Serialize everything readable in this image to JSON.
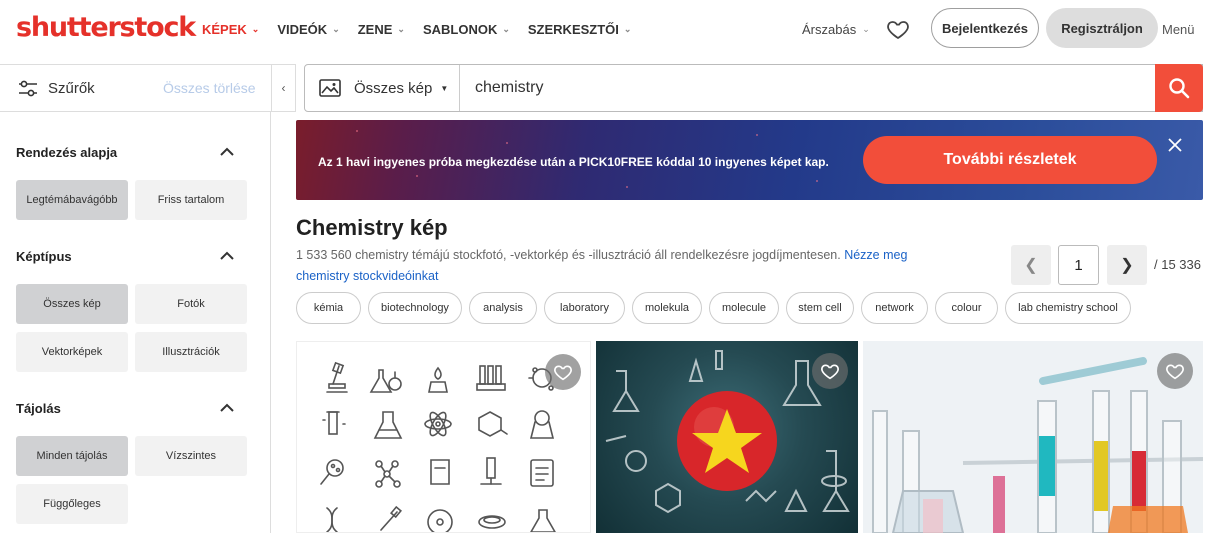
{
  "brand": {
    "logo_text": "shutterstock",
    "accent": "#e5312a"
  },
  "nav": {
    "items": [
      {
        "label": "KÉPEK",
        "active": true
      },
      {
        "label": "VIDEÓK",
        "active": false
      },
      {
        "label": "ZENE",
        "active": false
      },
      {
        "label": "SABLONOK",
        "active": false
      },
      {
        "label": "SZERKESZTŐI",
        "active": false
      }
    ],
    "pricing": "Árszabás",
    "login": "Bejelentkezés",
    "register": "Regisztráljon",
    "menu": "Menü"
  },
  "filters": {
    "label": "Szűrők",
    "clear_all": "Összes törlése"
  },
  "search": {
    "type_label": "Összes kép",
    "query": "chemistry"
  },
  "sidebar": {
    "sort": {
      "title": "Rendezés alapja",
      "options": [
        "Legtémábavágóbb",
        "Friss tartalom"
      ],
      "selected": 0
    },
    "type": {
      "title": "Képtípus",
      "options": [
        "Összes kép",
        "Fotók",
        "Vektorképek",
        "Illusztrációk"
      ],
      "selected": 0
    },
    "orientation": {
      "title": "Tájolás",
      "options": [
        "Minden tájolás",
        "Vízszintes",
        "Függőleges"
      ],
      "selected": 0
    }
  },
  "banner": {
    "text": "Az 1 havi ingyenes próba megkezdése után a PICK10FREE kóddal 10 ingyenes képet kap.",
    "button": "További részletek"
  },
  "results": {
    "title": "Chemistry kép",
    "description": "1 533 560 chemistry témájú stockfotó, -vektorkép és -illusztráció áll rendelkezésre jogdíjmentesen.",
    "video_link": "Nézze meg chemistry stockvideóinkat",
    "page": "1",
    "total_pages": "/ 15 336"
  },
  "chips": [
    "kémia",
    "biotechnology",
    "analysis",
    "laboratory",
    "molekula",
    "molecule",
    "stem cell",
    "network",
    "colour",
    "lab chemistry school"
  ]
}
